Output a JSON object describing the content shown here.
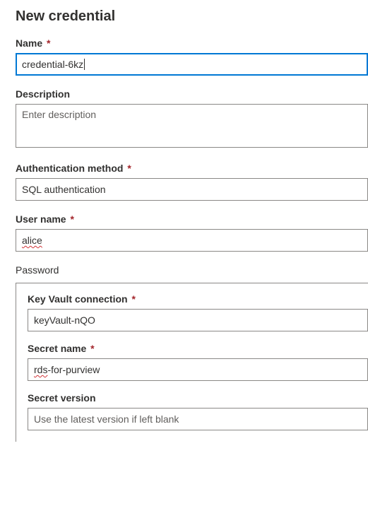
{
  "title": "New credential",
  "labels": {
    "name": "Name",
    "description": "Description",
    "auth_method": "Authentication method",
    "user_name": "User name",
    "password_section": "Password",
    "key_vault_connection": "Key Vault connection",
    "secret_name": "Secret name",
    "secret_version": "Secret version"
  },
  "required_marker": "*",
  "values": {
    "name": "credential-6kz",
    "auth_method": "SQL authentication",
    "user_name": "alice",
    "key_vault_connection": "keyVault-nQO",
    "secret_name_prefix": "rds",
    "secret_name_suffix": "-for-purview"
  },
  "placeholders": {
    "description": "Enter description",
    "secret_version": "Use the latest version if left blank"
  }
}
